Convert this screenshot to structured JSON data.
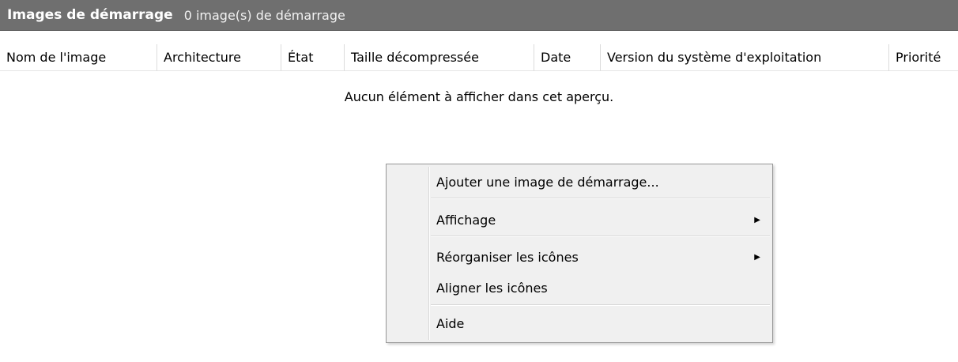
{
  "header": {
    "title": "Images de démarrage",
    "count": "0 image(s) de démarrage"
  },
  "columns": [
    "Nom de l'image",
    "Architecture",
    "État",
    "Taille décompressée",
    "Date",
    "Version du système d'exploitation",
    "Priorité"
  ],
  "empty_message": "Aucun élément à afficher dans cet aperçu.",
  "context_menu": {
    "items": [
      {
        "label": "Ajouter une image de démarrage..."
      },
      {
        "label": "Affichage",
        "icon": "submenu-arrow-icon"
      },
      {
        "label": "Réorganiser les icônes",
        "icon": "submenu-arrow-icon"
      },
      {
        "label": "Aligner les icônes"
      },
      {
        "label": "Aide"
      }
    ]
  }
}
